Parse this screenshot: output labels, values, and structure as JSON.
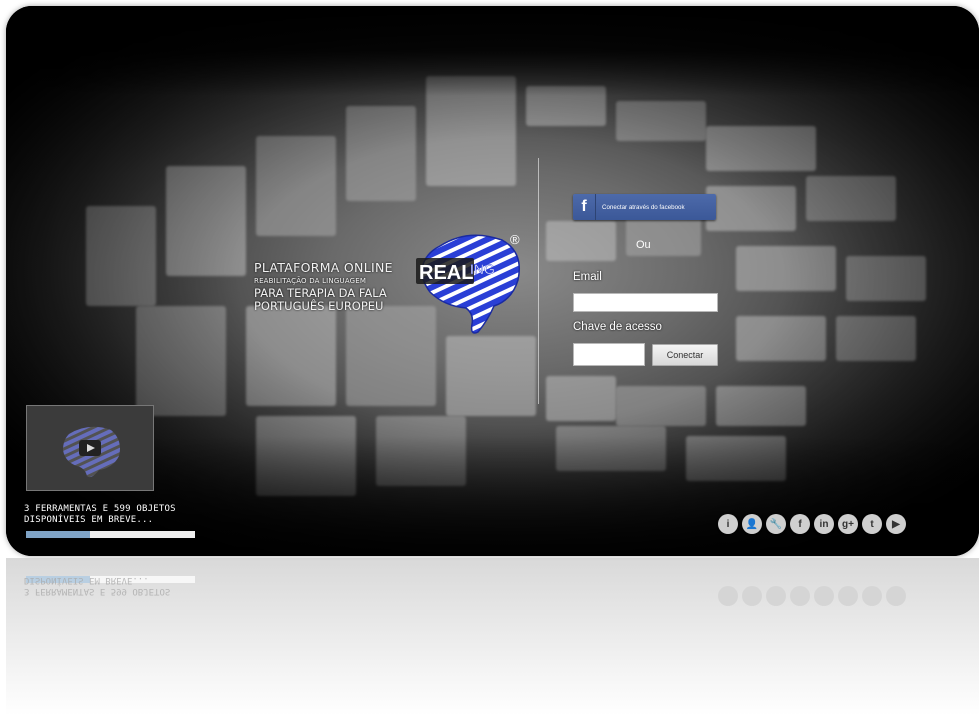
{
  "brand": {
    "logo_text": "REALING",
    "logo_registered": "®"
  },
  "tagline": {
    "line1": "PLATAFORMA ONLINE",
    "line2": "REABILITAÇÃO DA LINGUAGEM",
    "line3": "PARA TERAPIA DA FALA",
    "line4": "PORTUGUÊS EUROPEU"
  },
  "login": {
    "facebook_label": "Conectar através do facebook",
    "facebook_icon": "f",
    "or_label": "Ou",
    "email_label": "Email",
    "email_value": "",
    "password_label": "Chave de acesso",
    "password_value": "",
    "submit_label": "Conectar"
  },
  "status": {
    "line1": "3 FERRAMENTAS E 599 OBJETOS",
    "line2": "DISPONÍVEIS EM BREVE...",
    "progress": 0.38
  },
  "social": [
    {
      "name": "info-icon",
      "glyph": "i"
    },
    {
      "name": "user-icon",
      "glyph": "👤"
    },
    {
      "name": "wrench-icon",
      "glyph": "🔧"
    },
    {
      "name": "facebook-icon",
      "glyph": "f"
    },
    {
      "name": "linkedin-icon",
      "glyph": "in"
    },
    {
      "name": "googleplus-icon",
      "glyph": "g+"
    },
    {
      "name": "twitter-icon",
      "glyph": "t"
    },
    {
      "name": "youtube-icon",
      "glyph": "▶"
    }
  ],
  "colors": {
    "facebook": "#3b5898",
    "logo_blue": "#2a3fd6",
    "progress_fill": "#7fa3c6"
  }
}
